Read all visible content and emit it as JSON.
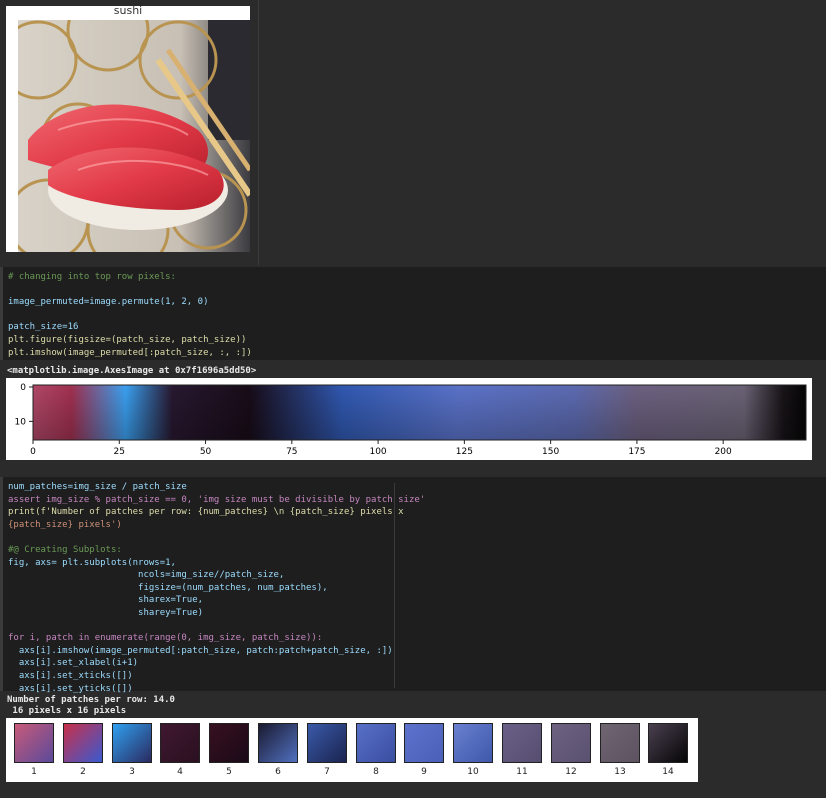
{
  "sushi_output": {
    "title": "sushi"
  },
  "cell1": {
    "lines": [
      "# changing into top row pixels:",
      "",
      "image_permuted=image.permute(1, 2, 0)",
      "",
      "patch_size=16",
      "plt.figure(figsize=(patch_size, patch_size))",
      "plt.imshow(image_permuted[:patch_size, :, :])"
    ]
  },
  "cell1_output": {
    "repr": "<matplotlib.image.AxesImage at 0x7f1696a5dd50>"
  },
  "chart_data": {
    "type": "heatmap",
    "xticks": [
      "0",
      "25",
      "50",
      "75",
      "100",
      "125",
      "150",
      "175",
      "200"
    ],
    "yticks": [
      "0",
      "10"
    ],
    "xlim": [
      0,
      224
    ],
    "ylim": [
      16,
      0
    ]
  },
  "cell2": {
    "lines": [
      "num_patches=img_size / patch_size",
      "assert img_size % patch_size == 0, 'img size must be divisible by patch size'",
      "print(f'Number of patches per row: {num_patches} \\n {patch_size} pixels x",
      "{patch_size} pixels')",
      "",
      "#@ Creating Subplots:",
      "fig, axs= plt.subplots(nrows=1,",
      "                        ncols=img_size//patch_size,",
      "                        figsize=(num_patches, num_patches),",
      "                        sharex=True,",
      "                        sharey=True)",
      "",
      "for i, patch in enumerate(range(0, img_size, patch_size)):",
      "  axs[i].imshow(image_permuted[:patch_size, patch:patch+patch_size, :])",
      "  axs[i].set_xlabel(i+1)",
      "  axs[i].set_xticks([])",
      "  axs[i].set_yticks([])"
    ]
  },
  "cell2_output": {
    "line1": "Number of patches per row: 14.0",
    "line2": " 16 pixels x 16 pixels"
  },
  "patches": {
    "labels": [
      "1",
      "2",
      "3",
      "4",
      "5",
      "6",
      "7",
      "8",
      "9",
      "10",
      "11",
      "12",
      "13",
      "14"
    ],
    "colors": [
      [
        "#c85a7a",
        "#5a4a9a"
      ],
      [
        "#c8304a",
        "#3a5ad0"
      ],
      [
        "#30a0f0",
        "#2a2a60"
      ],
      [
        "#401830",
        "#2a1020"
      ],
      [
        "#381020",
        "#1a0a18"
      ],
      [
        "#1a1a30",
        "#5070c0"
      ],
      [
        "#3a5aa8",
        "#1a2450"
      ],
      [
        "#5870c8",
        "#3a4ea0"
      ],
      [
        "#5c72cc",
        "#4a60b8"
      ],
      [
        "#6a80d0",
        "#3e58aa"
      ],
      [
        "#6a6088",
        "#564e70"
      ],
      [
        "#6e6280",
        "#5a5070"
      ],
      [
        "#706672",
        "#5c5260"
      ],
      [
        "#4a4050",
        "#050505"
      ]
    ]
  }
}
